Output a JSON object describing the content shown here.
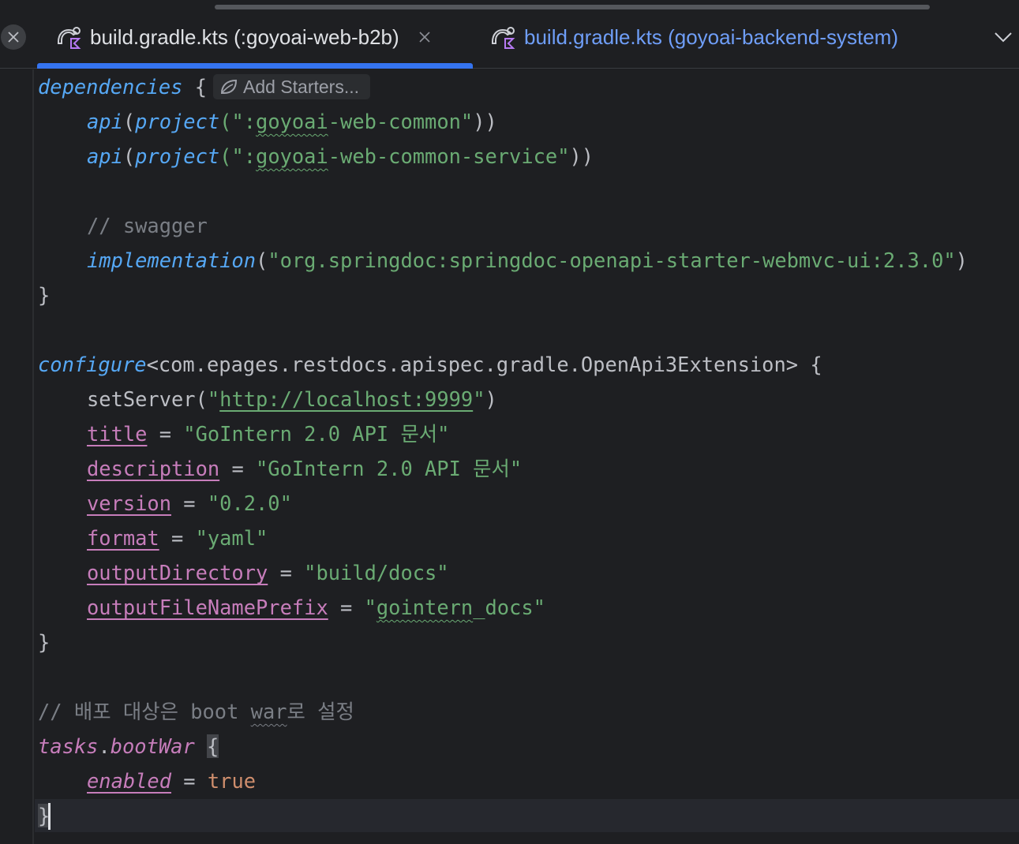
{
  "tabs": [
    {
      "label": "build.gradle.kts (:goyoai-web-b2b)",
      "icon": "gradle-kotlin-icon",
      "active": true
    },
    {
      "label": "build.gradle.kts (goyoai-backend-system)",
      "icon": "gradle-kotlin-icon",
      "active": false
    }
  ],
  "inlay": {
    "add_starters": "Add Starters..."
  },
  "code": {
    "l1_kw": "dependencies",
    "l1_brace": " {",
    "l2_fn": "api",
    "l2_p1": "(",
    "l2_fn2": "project",
    "l2_p2": "(\":",
    "l2_s1": "goyoai",
    "l2_s2": "-web-common\"",
    "l2_p3": "))",
    "l3_fn": "api",
    "l3_p1": "(",
    "l3_fn2": "project",
    "l3_p2": "(\":",
    "l3_s1": "goyoai",
    "l3_s2": "-web-common-service\"",
    "l3_p3": "))",
    "l5_comment": "// swagger",
    "l6_fn": "implementation",
    "l6_p1": "(",
    "l6_str": "\"org.springdoc:springdoc-openapi-starter-webmvc-ui:2.3.0\"",
    "l6_p2": ")",
    "l7_close": "}",
    "l9_kw": "configure",
    "l9_rest": "<com.epages.restdocs.apispec.gradle.OpenApi3Extension> {",
    "l10_a": "setServer(",
    "l10_q1": "\"",
    "l10_url": "http://localhost:9999",
    "l10_q2": "\"",
    "l10_b": ")",
    "l11_prop": "title",
    "l11_eq": " = ",
    "l11_str": "\"GoIntern 2.0 API 문서\"",
    "l12_prop": "description",
    "l12_eq": " = ",
    "l12_str": "\"GoIntern 2.0 API 문서\"",
    "l13_prop": "version",
    "l13_eq": " = ",
    "l13_str": "\"0.2.0\"",
    "l14_prop": "format",
    "l14_eq": " = ",
    "l14_str": "\"yaml\"",
    "l15_prop": "outputDirectory",
    "l15_eq": " = ",
    "l15_str": "\"build/docs\"",
    "l16_prop": "outputFileNamePrefix",
    "l16_eq": " = ",
    "l16_q": "\"",
    "l16_s1": "gointern",
    "l16_s2": "_docs\"",
    "l17_close": "}",
    "l19_c1": "// 배포 대상은 boot ",
    "l19_c2": "war",
    "l19_c3": "로 설정",
    "l20_prop": "tasks",
    "l20_dot": ".",
    "l20_prop2": "bootWar",
    "l20_sp": " ",
    "l20_brace": "{",
    "l21_prop": "enabled",
    "l21_eq": " = ",
    "l21_val": "true",
    "l22_close": "}"
  },
  "colors": {
    "background": "#1e1f22",
    "accent": "#3574f0",
    "keyword": "#56a8f5",
    "string": "#6aab73",
    "property": "#c77dbb",
    "comment": "#7a7e85",
    "literal": "#cf8e6d"
  }
}
